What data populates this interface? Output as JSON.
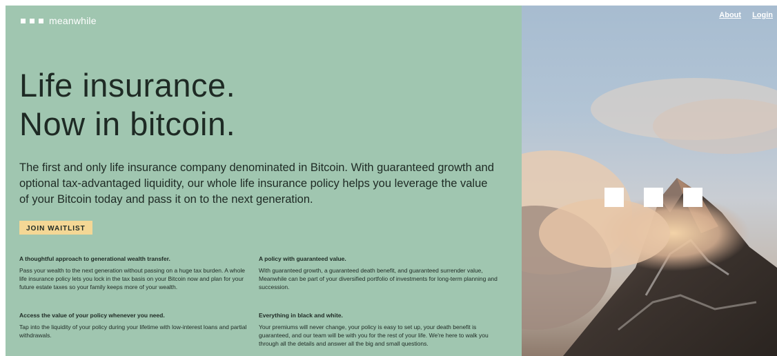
{
  "header": {
    "logo_text": "meanwhile",
    "nav": [
      {
        "label": "About"
      },
      {
        "label": "Login"
      }
    ]
  },
  "hero": {
    "title_line1": "Life insurance.",
    "title_line2": "Now in bitcoin.",
    "subcopy": "The first and only life insurance company denominated in Bitcoin. With guaranteed growth and optional tax-advantaged liquidity, our whole life insurance policy helps you leverage the value of your Bitcoin today and pass it on to the next generation.",
    "cta_label": "JOIN WAITLIST"
  },
  "features": [
    {
      "title": "A thoughtful approach to generational wealth transfer.",
      "body": "Pass your wealth to the next generation without passing on a huge tax burden. A whole life insurance policy lets you lock in the tax basis on your Bitcoin now and plan for your future estate taxes so your family keeps more of your wealth."
    },
    {
      "title": "A policy with guaranteed value.",
      "body": "With guaranteed growth, a guaranteed death benefit, and guaranteed surrender value, Meanwhile can be part of your diversified portfolio of investments for long-term planning and succession."
    },
    {
      "title": "Access the value of your policy whenever you need.",
      "body": "Tap into the liquidity of your policy during your lifetime with low-interest loans and partial withdrawals."
    },
    {
      "title": "Everything in black and white.",
      "body": "Your premiums will never change, your policy is easy to set up, your death benefit is guaranteed, and our team will be with you for the rest of your life. We're here to walk you through all the details and answer all the big and small questions."
    }
  ],
  "colors": {
    "panel_green": "#a0c6b0",
    "cta_yellow": "#f4d795",
    "text_dark": "#1e2a24"
  },
  "icons": {
    "logo": "three-white-squares",
    "photo_overlay": "three-white-squares"
  }
}
